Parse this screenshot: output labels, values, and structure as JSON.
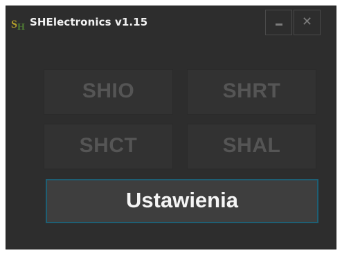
{
  "window": {
    "title": "SHElectronics v1.15",
    "minimize_label": "_",
    "close_label": "✕"
  },
  "modules": [
    {
      "label": "SHIO"
    },
    {
      "label": "SHRT"
    },
    {
      "label": "SHCT"
    },
    {
      "label": "SHAL"
    }
  ],
  "settings": {
    "label": "Ustawienia"
  },
  "colors": {
    "window_bg": "#2d2d2d",
    "disabled_text": "#555555",
    "accent_border": "#1e5f74",
    "title_text": "#f2f2f2"
  }
}
